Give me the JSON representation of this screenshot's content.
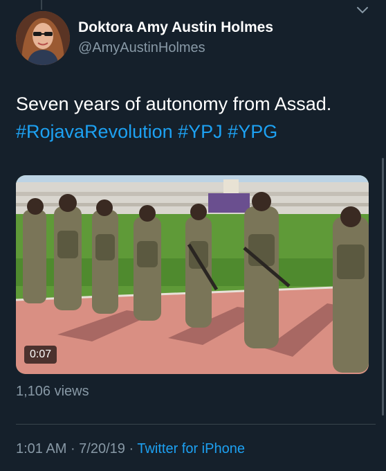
{
  "author": {
    "display_name": "Doktora Amy Austin Holmes",
    "handle": "@AmyAustinHolmes"
  },
  "tweet": {
    "text": "Seven years of autonomy from Assad.",
    "hashtags": "#RojavaRevolution #YPJ #YPG"
  },
  "media": {
    "type": "video",
    "duration": "0:07"
  },
  "stats": {
    "views": "1,106 views"
  },
  "meta": {
    "time": "1:01 AM",
    "separator1": " · ",
    "date": "7/20/19",
    "separator2": " · ",
    "source": "Twitter for iPhone"
  },
  "icons": {
    "more": "chevron-down-icon"
  },
  "colors": {
    "background": "#15202b",
    "link": "#1da1f2",
    "secondary_text": "#8899a6"
  }
}
